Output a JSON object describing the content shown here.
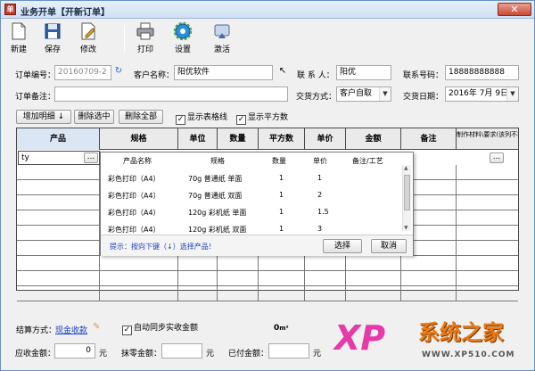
{
  "window": {
    "title": "业务开单【开新订单】",
    "close_glyph": "✕"
  },
  "toolbar": {
    "new_label": "新建",
    "save_label": "保存",
    "edit_label": "修改",
    "print_label": "打印",
    "settings_label": "设置",
    "activate_label": "激活"
  },
  "order": {
    "number_label": "订单编号：",
    "number_value": "20160709-2",
    "customer_label": "客户名称：",
    "customer_value": "阳优软件",
    "contact_label": "联 系 人：",
    "contact_value": "阳优",
    "phone_label": "联系号码：",
    "phone_value": "18888888888",
    "note_label": "订单备注：",
    "note_value": "",
    "pay_method_label": "交货方式：",
    "pay_method_value": "客户自取",
    "delivery_label": "交货日期：",
    "delivery_value": "2016年 7月 9日"
  },
  "actions": {
    "add_row": "增加明细",
    "delete_selected": "删除选中",
    "delete_all": "删除全部",
    "show_grid_lines": "显示表格线",
    "show_sqm": "显示平方数"
  },
  "grid": {
    "headers": [
      "产品",
      "规格",
      "单位",
      "数量",
      "平方数",
      "单价",
      "金额",
      "备注",
      "制作材料\\要求(该列不打印)"
    ],
    "first_cell_value": "ty",
    "ellipsis": "..."
  },
  "popup": {
    "headers": [
      "产品名称",
      "规格",
      "数量",
      "单价",
      "备注/工艺"
    ],
    "rows": [
      {
        "name": "彩色打印（A4）",
        "spec": "70g 普通纸 单面",
        "qty": "1",
        "price": "1"
      },
      {
        "name": "彩色打印（A4）",
        "spec": "70g 普通纸 双面",
        "qty": "1",
        "price": "2"
      },
      {
        "name": "彩色打印（A4）",
        "spec": "120g 彩机纸 单面",
        "qty": "1",
        "price": "1.5"
      },
      {
        "name": "彩色打印（A4）",
        "spec": "120g 彩机纸 双面",
        "qty": "1",
        "price": "3"
      }
    ],
    "hint": "提示：按向下键（↓）选择产品！",
    "select_label": "选择",
    "cancel_label": "取消"
  },
  "footer": {
    "settle_label": "结算方式：",
    "settle_value": "现金收款",
    "auto_sync": "自动同步实收金额",
    "total_value": "0",
    "total_unit": "m²",
    "receivable_label": "应收金额：",
    "receivable_value": "0",
    "yuan1": "元",
    "discount_label": "抹零金额：",
    "discount_value": "",
    "yuan2": "元",
    "paid_label": "已付金额：",
    "paid_value": "",
    "yuan3": "元"
  },
  "watermark": {
    "brand": "系统之家",
    "url": "WWW.XP510.COM",
    "logo": "XP"
  },
  "colors": {
    "accent": "#1f5fb8",
    "blue_link": "#1a3fc4",
    "title": "#1a2a44"
  }
}
